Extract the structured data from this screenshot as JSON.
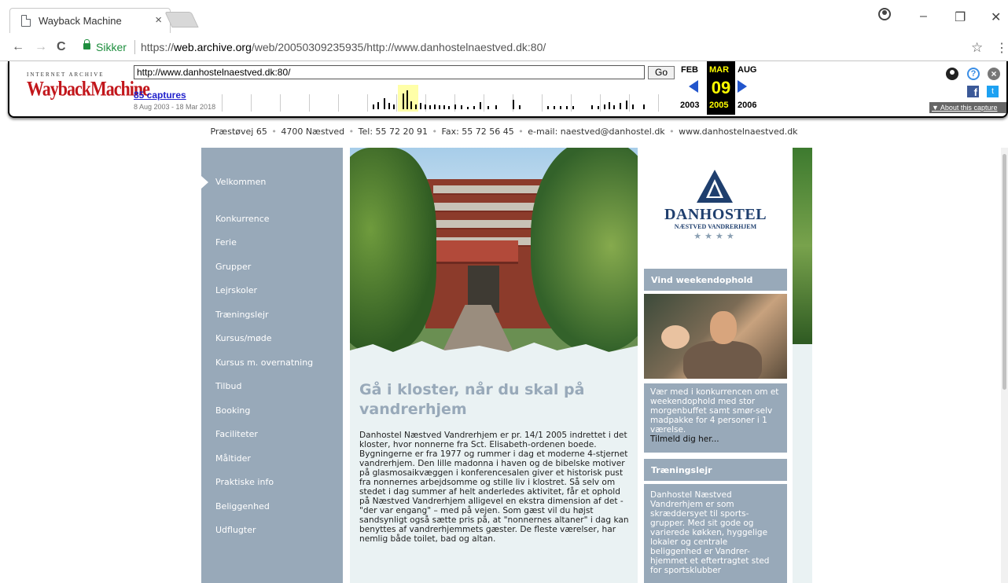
{
  "browser": {
    "tab_title": "Wayback Machine",
    "tab_close": "×",
    "secure_label": "Sikker",
    "url_prefix": "https://",
    "url_domain": "web.archive.org",
    "url_path": "/web/20050309235935/http://www.danhostelnaestved.dk:80/",
    "back": "←",
    "forward": "→",
    "reload": "C",
    "star": "☆",
    "menu": "⋮",
    "minimize": "–",
    "restore": "❐",
    "close": "✕"
  },
  "wayback": {
    "logo_top": "INTERNET ARCHIVE",
    "logo": "WaybackMachine",
    "url_value": "http://www.danhostelnaestved.dk:80/",
    "go": "Go",
    "captures": "85 captures",
    "range": "8 Aug 2003 - 18 Mar 2018",
    "prev_month": "FEB",
    "cur_month": "MAR",
    "next_month": "AUG",
    "day": "09",
    "prev_year": "2003",
    "cur_year": "2005",
    "next_year": "2006",
    "about": "▼ About this capture",
    "facebook": "f",
    "twitter": "t",
    "help": "?",
    "close": "×",
    "accent_color": "#ffff00"
  },
  "page": {
    "address": {
      "street": "Præstøvej 65",
      "city": "4700 Næstved",
      "tel": "Tel: 55 72 20 91",
      "fax": "Fax: 55 72 56 45",
      "email": "e-mail: naestved@danhostel.dk",
      "web": "www.danhostelnaestved.dk",
      "sep": "•"
    },
    "nav": [
      "Velkommen",
      "Konkurrence",
      "Ferie",
      "Grupper",
      "Lejrskoler",
      "Træningslejr",
      "Kursus/møde",
      "Kursus m. overnatning",
      "Tilbud",
      "Booking",
      "Faciliteter",
      "Måltider",
      "Praktiske info",
      "Beliggenhed",
      "Udflugter"
    ],
    "headline": "Gå i kloster, når du skal på vandrerhjem",
    "body": "Danhostel Næstved Vandrerhjem er pr. 14/1 2005 indrettet i det kloster, hvor nonnerne fra Sct. Elisabeth-ordenen boede. Bygningerne er fra 1977 og rummer i dag et moderne 4-stjernet vandrerhjem. Den lille madonna i haven og de bibelske motiver på glasmosaikvæggen i konferencesalen giver et historisk pust fra nonnernes arbejdsomme og stille liv i klostret. Så selv om stedet i dag summer af helt anderledes aktivitet, får et ophold på Næstved Vandrerhjem alligevel en ekstra dimension af det - \"der var engang\" – med på vejen. Som gæst vil du højst sandsynligt også sætte pris på, at \"nonnernes altaner\" i dag kan benyttes af vandrerhjemmets gæster. De fleste værelser, har nemlig både toilet, bad og altan.",
    "logo_name": "DANHOSTEL",
    "logo_sub": "NÆSTVED VANDRERHJEM",
    "logo_stars": "★★★★",
    "box1_head": "Vind weekendophold",
    "box1_text": "Vær med i konkurrencen om et weekendophold med stor morgenbuffet samt smør-selv madpakke for 4 personer i 1 værelse.",
    "box1_link": "Tilmeld dig her...",
    "box2_head": "Træningslejr",
    "box2_text": "Danhostel Næstved Vandrerhjem er som skræddersyet til sports-grupper. Med sit gode og varierede køkken, hyggelige lokaler og centrale beliggenhed er Vandrer-hjemmet et eftertragtet sted for sportsklubber",
    "colors": {
      "nav_bg": "#98a9b9",
      "content_bg": "#eaf2f3",
      "headline": "#98a9b9",
      "logo": "#1f3f6e"
    }
  }
}
